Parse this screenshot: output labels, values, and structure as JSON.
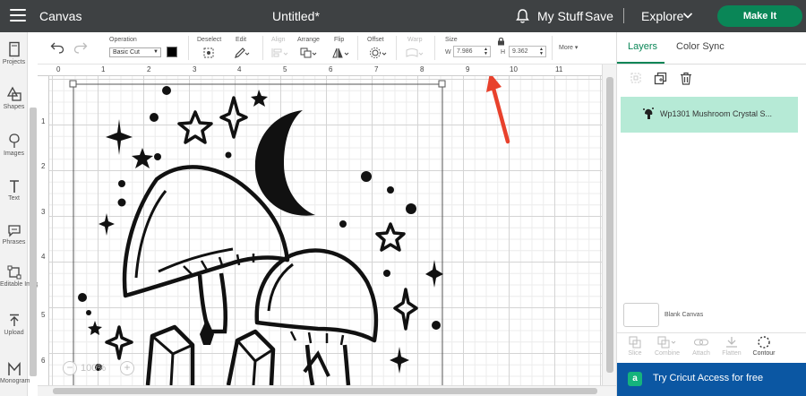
{
  "header": {
    "app_title": "Canvas",
    "doc_title": "Untitled*",
    "my_stuff": "My Stuff",
    "save": "Save",
    "explore": "Explore",
    "make_it": "Make It"
  },
  "left_rail": [
    {
      "label": "Projects",
      "icon": "projects-icon"
    },
    {
      "label": "Shapes",
      "icon": "shapes-icon"
    },
    {
      "label": "Images",
      "icon": "images-icon"
    },
    {
      "label": "Text",
      "icon": "text-icon"
    },
    {
      "label": "Phrases",
      "icon": "phrases-icon"
    },
    {
      "label": "Editable Images",
      "icon": "editable-images-icon"
    },
    {
      "label": "Upload",
      "icon": "upload-icon"
    },
    {
      "label": "Monogram",
      "icon": "monogram-icon"
    }
  ],
  "toolbar": {
    "operation_label": "Operation",
    "operation_value": "Basic Cut",
    "operation_color": "#000000",
    "deselect_label": "Deselect",
    "edit_label": "Edit",
    "align_label": "Align",
    "arrange_label": "Arrange",
    "flip_label": "Flip",
    "offset_label": "Offset",
    "warp_label": "Warp",
    "size_label": "Size",
    "width_label": "W",
    "width_value": "7.986",
    "height_label": "H",
    "height_value": "9.362",
    "more_label": "More"
  },
  "ruler": {
    "horizontal": [
      "0",
      "1",
      "2",
      "3",
      "4",
      "5",
      "6",
      "7",
      "8",
      "9",
      "10",
      "11"
    ],
    "vertical": [
      "1",
      "2",
      "3",
      "4",
      "5",
      "6"
    ]
  },
  "zoom": {
    "value": "100%"
  },
  "right_panel": {
    "tab_layers": "Layers",
    "tab_color_sync": "Color Sync",
    "layer_name": "Wp1301 Mushroom Crystal S...",
    "blank_canvas": "Blank Canvas",
    "tools": [
      {
        "label": "Slice",
        "icon": "slice-icon",
        "enabled": false
      },
      {
        "label": "Combine",
        "icon": "combine-icon",
        "enabled": false
      },
      {
        "label": "Attach",
        "icon": "attach-icon",
        "enabled": false
      },
      {
        "label": "Flatten",
        "icon": "flatten-icon",
        "enabled": false
      },
      {
        "label": "Contour",
        "icon": "contour-icon",
        "enabled": true
      }
    ],
    "promo": "Try Cricut Access for free"
  },
  "colors": {
    "header_bg": "#3e4143",
    "accent_green": "#0a8657",
    "layer_highlight": "#b6ead6",
    "promo_blue": "#0b57a3",
    "annotation_arrow": "#e8412c"
  }
}
